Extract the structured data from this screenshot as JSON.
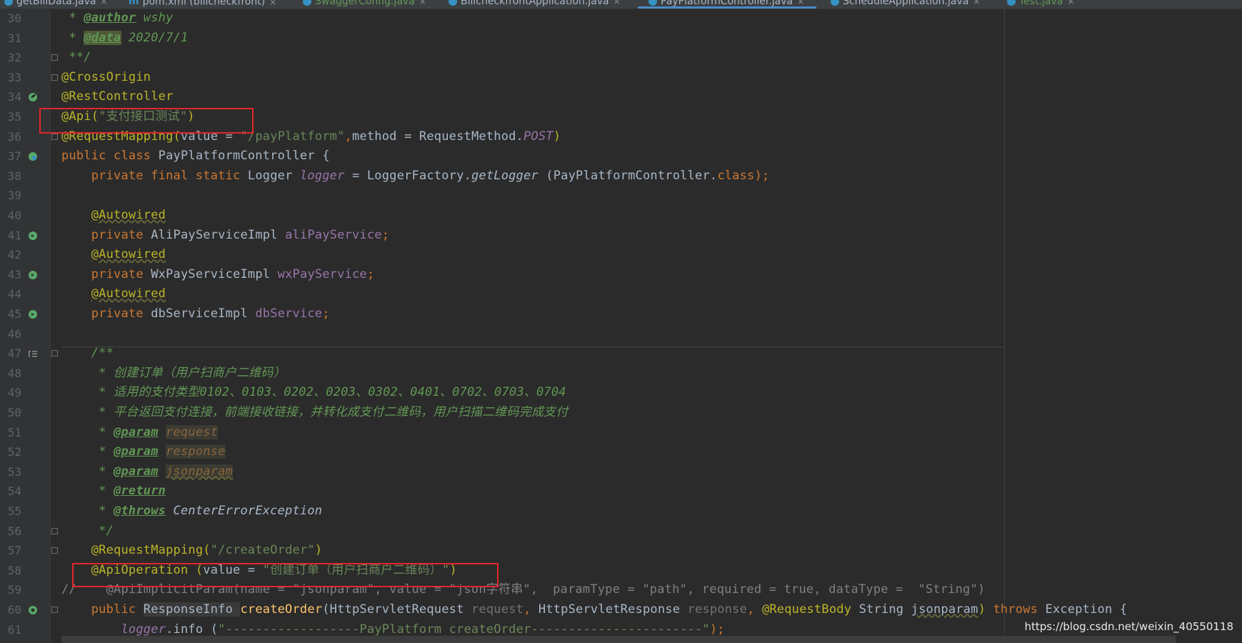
{
  "tabs": [
    {
      "label": "getBillData.java",
      "icon": "java-class-icon"
    },
    {
      "label": "pom.xml (billcheckfront)",
      "icon": "maven-icon"
    },
    {
      "label": "SwaggerConfig.java",
      "icon": "java-class-icon"
    },
    {
      "label": "BillcheckfrontApplication.java",
      "icon": "java-class-icon"
    },
    {
      "label": "PayPlatformController.java",
      "icon": "java-class-icon"
    },
    {
      "label": "ScheduleApplication.java",
      "icon": "java-class-icon"
    },
    {
      "label": "Test.java",
      "icon": "java-class-icon"
    }
  ],
  "tab_close_glyph": "×",
  "active_tab": "PayPlatformController.java",
  "line_numbers": [
    "30",
    "31",
    "32",
    "33",
    "34",
    "35",
    "36",
    "37",
    "38",
    "39",
    "40",
    "41",
    "42",
    "43",
    "44",
    "45",
    "46",
    "47",
    "48",
    "49",
    "50",
    "51",
    "52",
    "53",
    "54",
    "55",
    "56",
    "57",
    "58",
    "59",
    "60",
    "61"
  ],
  "code": {
    "l30": [
      " * ",
      "@author",
      " wshy"
    ],
    "l31": [
      " * ",
      "@data",
      " 2020/7/1"
    ],
    "l32": [
      " **/"
    ],
    "l33": [
      "@CrossOrigin"
    ],
    "l34": [
      "@RestController"
    ],
    "l35": [
      "@Api(",
      "\"支付接口测试\"",
      ")"
    ],
    "l36": [
      "@RequestMapping(",
      "value = ",
      "\"/payPlatform\"",
      ",",
      "method = RequestMethod.",
      "POST",
      ")"
    ],
    "l37": [
      "public class ",
      "PayPlatformController {"
    ],
    "l38": [
      "    ",
      "private final static ",
      "Logger ",
      "logger",
      " = LoggerFactory.",
      "getLogger",
      " (PayPlatformController.",
      "class",
      ");"
    ],
    "l39": [
      ""
    ],
    "l40": [
      "    ",
      "@Autowired"
    ],
    "l41": [
      "    ",
      "private ",
      "AliPayServiceImpl ",
      "aliPayService",
      ";"
    ],
    "l42": [
      "    ",
      "@Autowired"
    ],
    "l43": [
      "    ",
      "private ",
      "WxPayServiceImpl ",
      "wxPayService",
      ";"
    ],
    "l44": [
      "    ",
      "@Autowired"
    ],
    "l45": [
      "    ",
      "private ",
      "dbServiceImpl ",
      "dbService",
      ";"
    ],
    "l46": [
      ""
    ],
    "l47": [
      "    /**"
    ],
    "l48": [
      "     * 创建订单（用户扫商户二维码）"
    ],
    "l49": [
      "     * 适用的支付类型0102、0103、0202、0203、0302、0401、0702、0703、0704"
    ],
    "l50": [
      "     * 平台返回支付连接，前端接收链接，并转化成支付二维码，用户扫描二维码完成支付"
    ],
    "l51": [
      "     * ",
      "@param",
      " ",
      "request"
    ],
    "l52": [
      "     * ",
      "@param",
      " ",
      "response"
    ],
    "l53": [
      "     * ",
      "@param",
      " ",
      "jsonparam"
    ],
    "l54": [
      "     * ",
      "@return"
    ],
    "l55": [
      "     * ",
      "@throws",
      " ",
      "CenterErrorException"
    ],
    "l56": [
      "     */"
    ],
    "l57": [
      "    ",
      "@RequestMapping(",
      "\"/createOrder\"",
      ")"
    ],
    "l58": [
      "    ",
      "@ApiOperation",
      " (",
      "value",
      " = ",
      "\"创建订单（用户扫商户二维码）\"",
      ")"
    ],
    "l59": [
      "//    @ApiImplicitParam(name = \"jsonparam\", value = \"json字符串\",  paramType = \"path\", required = true, dataType =  \"String\")"
    ],
    "l60": [
      "    ",
      "public ",
      "ResponseInfo ",
      "createOrder",
      "(HttpServletRequest ",
      "request",
      ", ",
      "HttpServletResponse ",
      "response",
      ", ",
      "@RequestBody",
      " String ",
      "jsonparam",
      ") ",
      "throws ",
      "Exception {"
    ],
    "l61": [
      "        ",
      "logger",
      ".info (",
      "\"------------------PayPlatform createOrder-----------------------\"",
      ");"
    ]
  },
  "watermark": "https://blog.csdn.net/weixin_40550118",
  "colors": {
    "background": "#2b2b2b",
    "gutter": "#313335",
    "highlight_box": "#e2262d",
    "doc_comment": "#629755",
    "annotation": "#bbb529",
    "string": "#6a8759",
    "keyword": "#cc7832",
    "field": "#9876aa"
  }
}
